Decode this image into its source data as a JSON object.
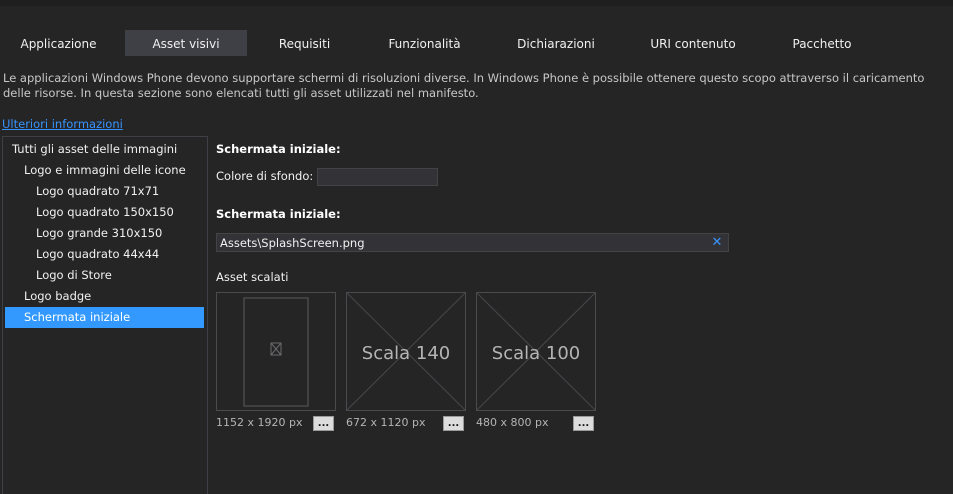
{
  "tabs": [
    {
      "label": "Applicazione"
    },
    {
      "label": "Asset visivi"
    },
    {
      "label": "Requisiti"
    },
    {
      "label": "Funzionalità"
    },
    {
      "label": "Dichiarazioni"
    },
    {
      "label": "URI contenuto"
    },
    {
      "label": "Pacchetto"
    }
  ],
  "active_tab": "Asset visivi",
  "description": "Le applicazioni Windows Phone devono supportare schermi di risoluzioni diverse. In Windows Phone è possibile ottenere questo scopo attraverso il caricamento delle risorse. In questa sezione sono elencati tutti gli asset utilizzati nel manifesto.",
  "more_info_link": "Ulteriori informazioni",
  "tree": {
    "items": [
      {
        "label": "Tutti gli asset delle immagini"
      },
      {
        "label": "Logo e immagini delle icone"
      },
      {
        "label": "Logo quadrato 71x71"
      },
      {
        "label": "Logo quadrato 150x150"
      },
      {
        "label": "Logo grande 310x150"
      },
      {
        "label": "Logo quadrato 44x44"
      },
      {
        "label": "Logo di Store"
      },
      {
        "label": "Logo badge"
      },
      {
        "label": "Schermata iniziale"
      }
    ],
    "selected": "Schermata iniziale"
  },
  "splash": {
    "heading1": "Schermata iniziale:",
    "bg_color_label": "Colore di sfondo:",
    "bg_color_value": "",
    "heading2": "Schermata iniziale:",
    "path_value": "Assets\\SplashScreen.png",
    "clear_icon": "close-icon",
    "scaled_assets_label": "Asset scalati"
  },
  "tiles": [
    {
      "label": "",
      "size": "1152 x 1920 px",
      "button": "..."
    },
    {
      "label": "Scala 140",
      "size": "672 x 1120 px",
      "button": "..."
    },
    {
      "label": "Scala 100",
      "size": "480 x 800 px",
      "button": "..."
    }
  ],
  "colors": {
    "background": "#252526",
    "tab_active": "#3f3f46",
    "selection": "#3399ff",
    "link": "#3794ff"
  }
}
